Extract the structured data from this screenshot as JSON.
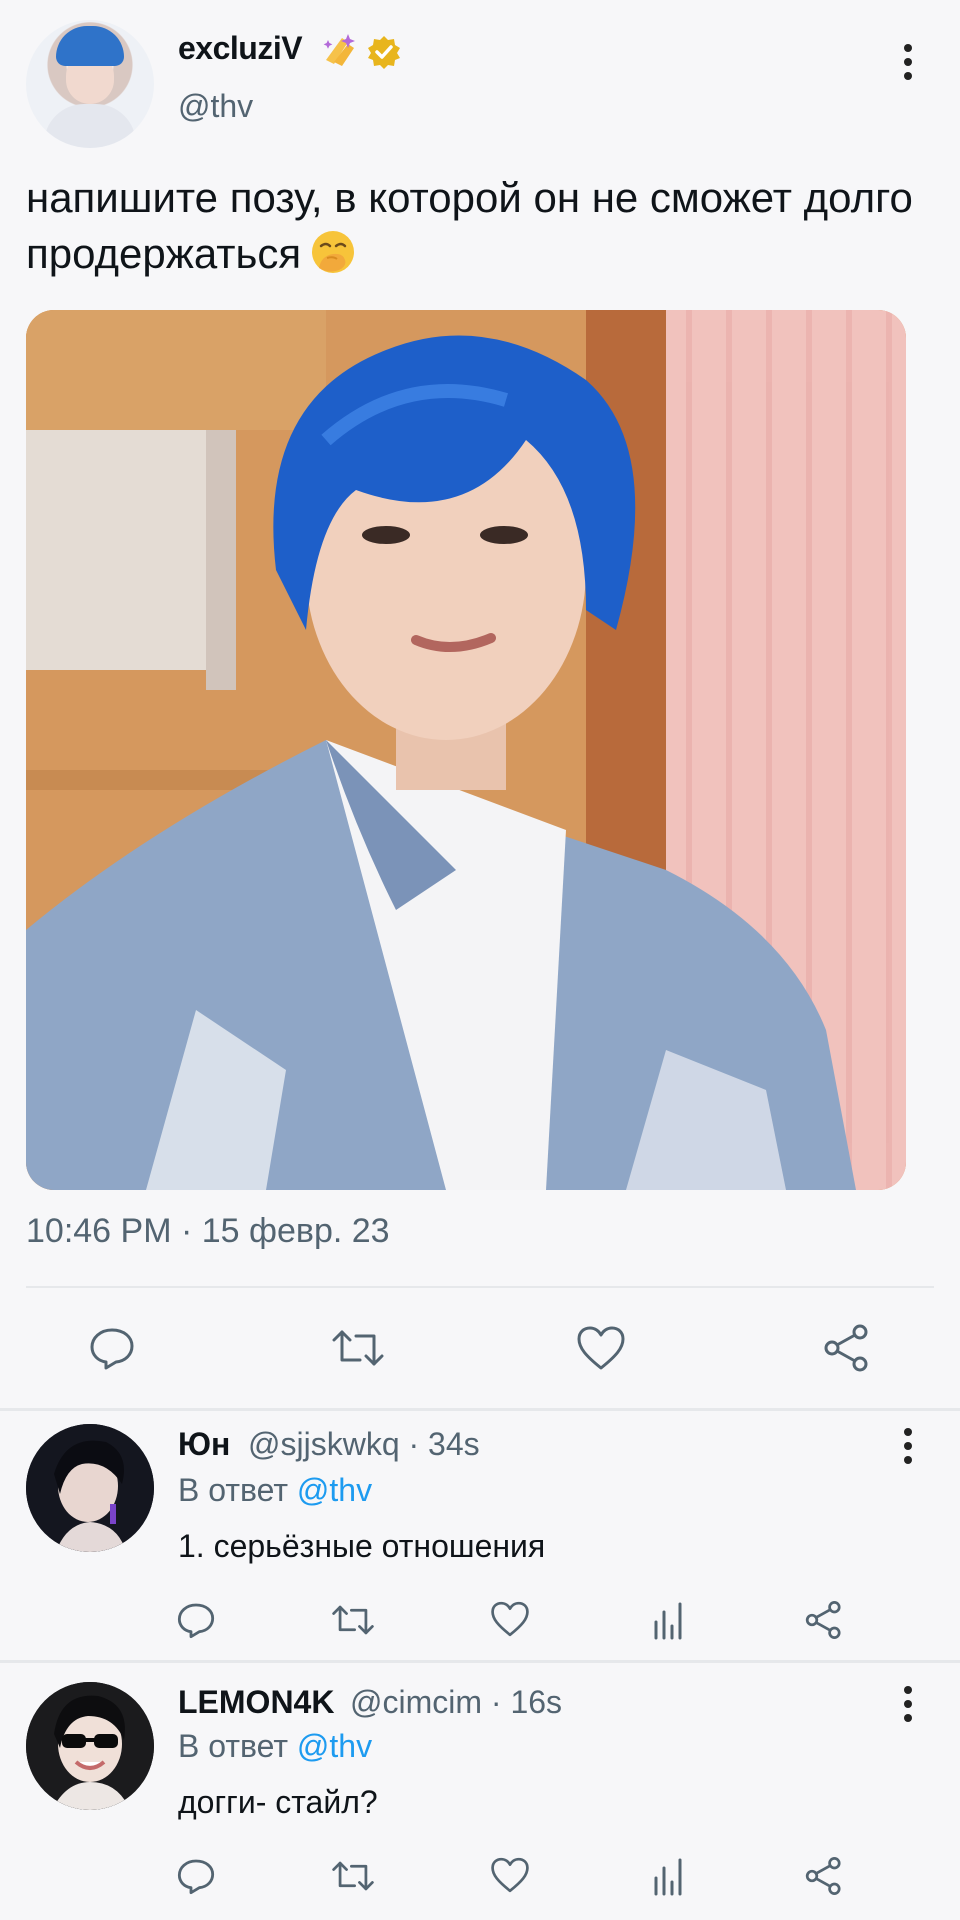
{
  "tweet": {
    "author": {
      "display_name": "excluziV",
      "handle": "@thv",
      "avatar": "avatar-blue-hair",
      "verified": true,
      "name_emoji": "sparkles-hands-emoji"
    },
    "text": "напишите позу, в которой он не сможет долго продержаться",
    "text_emoji": "hand-over-mouth-emoji",
    "image": "photo-person-blue-hair-denim-jacket",
    "timestamp": "10:46 PM · 15 февр. 23",
    "actions": [
      {
        "icon": "reply-icon"
      },
      {
        "icon": "retweet-icon"
      },
      {
        "icon": "like-icon"
      },
      {
        "icon": "share-icon"
      }
    ]
  },
  "replies": [
    {
      "display_name": "Юн",
      "handle_meta": "@sjjskwkq · 34s",
      "reply_prefix": "В ответ",
      "mention": "@thv",
      "text": "1. серьёзные отношения",
      "avatar": "avatar-dark-photo"
    },
    {
      "display_name": "LEMON4K",
      "handle_meta": "@cimcim · 16s",
      "reply_prefix": "В ответ",
      "mention": "@thv",
      "text": "догги- стайл?",
      "avatar": "avatar-sunglasses-photo"
    }
  ],
  "reply_actions": [
    {
      "icon": "reply-icon"
    },
    {
      "icon": "retweet-icon"
    },
    {
      "icon": "like-icon"
    },
    {
      "icon": "analytics-icon"
    },
    {
      "icon": "share-icon"
    }
  ],
  "colors": {
    "background": "#f7f7f9",
    "text": "#0f1419",
    "secondary_text": "#536471",
    "mention": "#1d9bf0",
    "verified_badge": "#e8b51d",
    "divider": "#e6e8eb"
  }
}
